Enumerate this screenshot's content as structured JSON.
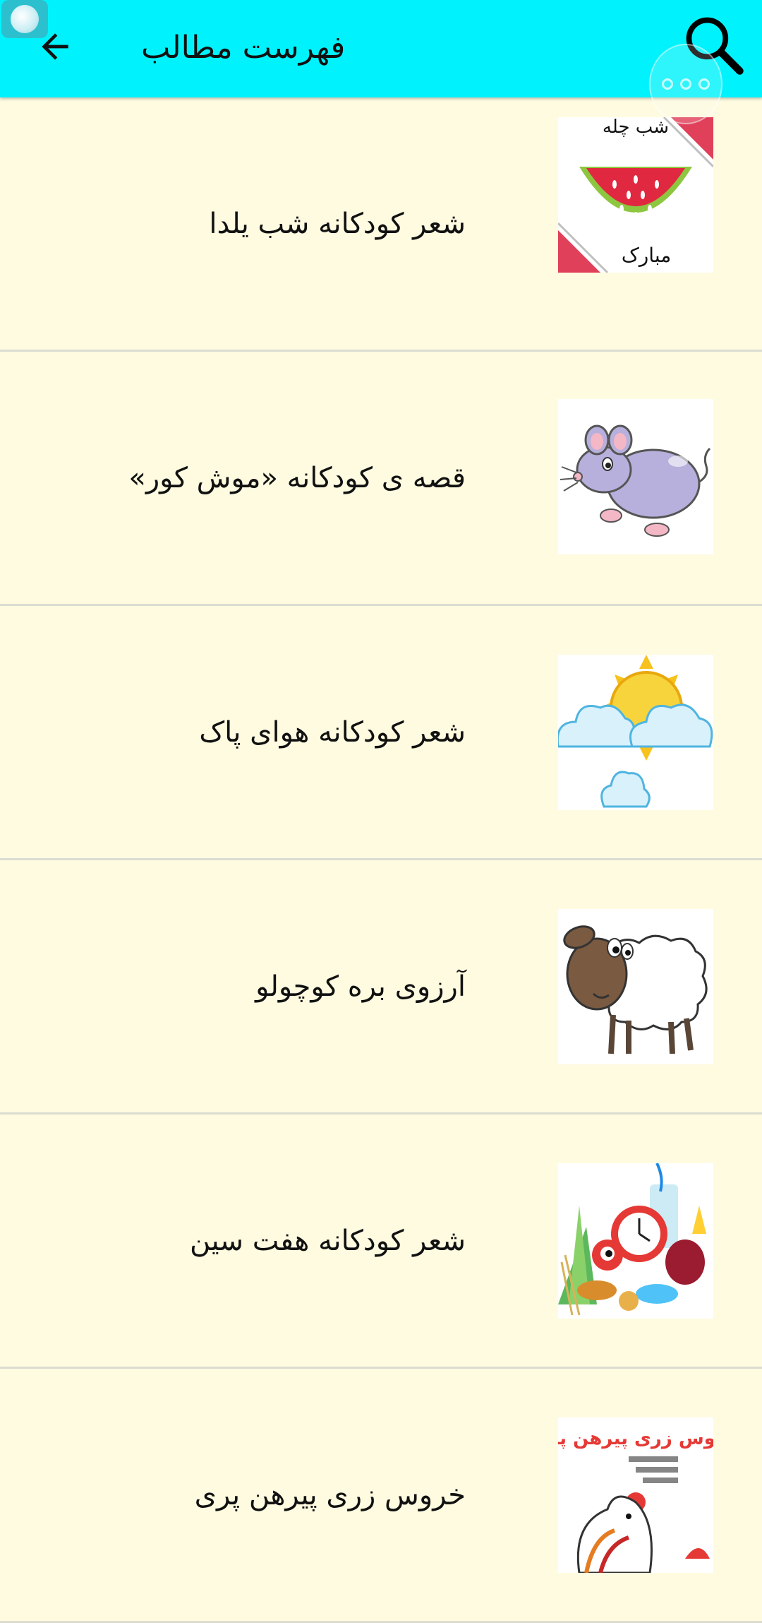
{
  "app_bar": {
    "title": "فهرست مطالب",
    "back_icon": "arrow-left-icon",
    "search_icon": "search-icon",
    "overflow_icon": "more-dots-icon",
    "background": "#00f3fc"
  },
  "items": [
    {
      "title": "شعر کودکانه شب یلدا",
      "thumbnail": "watermelon-yalda-image",
      "thumb_text_top": "شب چله",
      "thumb_text_bottom": "مبارک"
    },
    {
      "title": "قصه ی کودکانه «موش کور»",
      "thumbnail": "mouse-image"
    },
    {
      "title": "شعر کودکانه هوای پاک",
      "thumbnail": "sun-clouds-image"
    },
    {
      "title": "آرزوی بره کوچولو",
      "thumbnail": "sheep-image"
    },
    {
      "title": "شعر کودکانه هفت سین",
      "thumbnail": "haft-sin-image"
    },
    {
      "title": "خروس زری پیرهن پری",
      "thumbnail": "rooster-book-image",
      "thumb_text_top": "خروس زری پیرهن پری"
    }
  ]
}
